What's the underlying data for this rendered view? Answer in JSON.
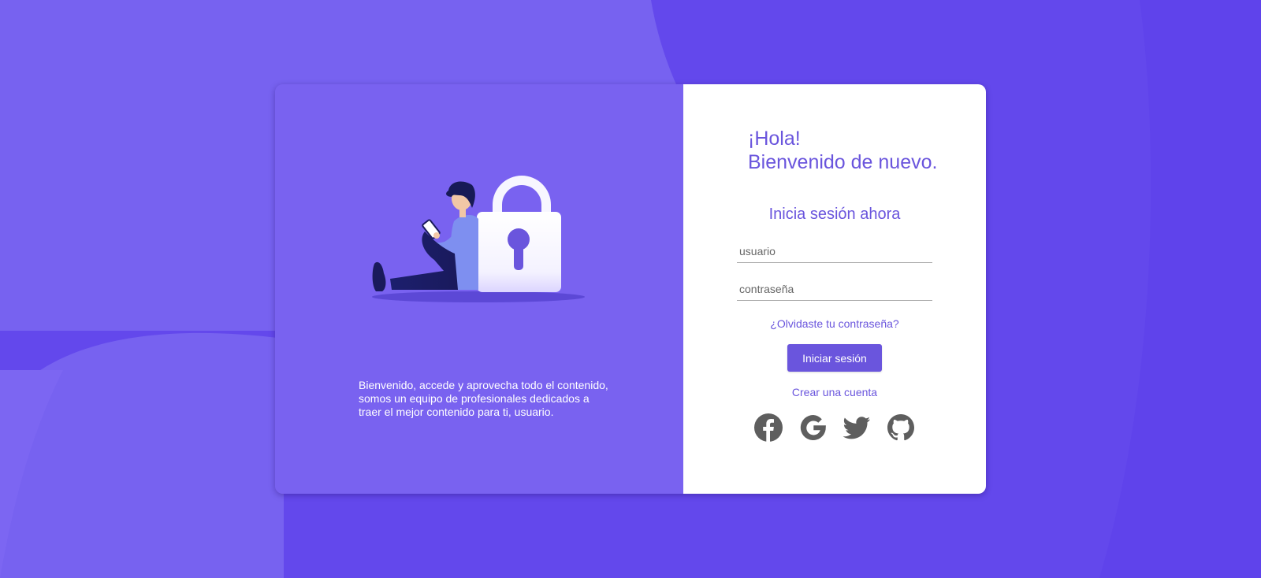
{
  "colors": {
    "background": "#6348ec",
    "panel": "#7962f0",
    "accent": "#6a55dd",
    "icon": "#5e5e5e",
    "white": "#ffffff"
  },
  "illustration": {
    "icon": "person-with-padlock-illustration"
  },
  "left_panel": {
    "intro_text": "Bienvenido, accede y aprovecha todo el contenido, somos un equipo de profesionales dedicados a traer el mejor contenido para ti, usuario."
  },
  "right_panel": {
    "greeting_line1": "¡Hola!",
    "greeting_line2": "Bienvenido de nuevo.",
    "login_title": "Inicia sesión ahora",
    "username_placeholder": "usuario",
    "password_placeholder": "contraseña",
    "forgot_password": "¿Olvidaste tu contraseña?",
    "login_button": "Iniciar sesión",
    "create_account": "Crear una cuenta"
  },
  "social": [
    {
      "icon": "facebook-icon"
    },
    {
      "icon": "google-icon"
    },
    {
      "icon": "twitter-icon"
    },
    {
      "icon": "github-icon"
    }
  ]
}
